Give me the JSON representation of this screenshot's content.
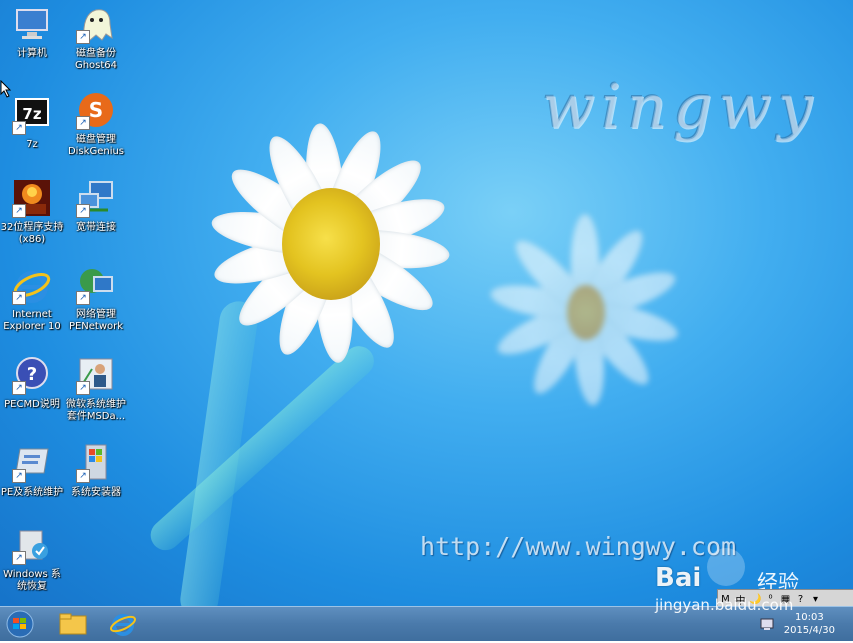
{
  "desktop": {
    "icons": [
      {
        "label": "计算机",
        "icon": "computer-icon"
      },
      {
        "label": "磁盘备份\nGhost64",
        "icon": "ghost-icon"
      },
      {
        "label": "7z",
        "icon": "7zip-icon"
      },
      {
        "label": "磁盘管理\nDiskGenius",
        "icon": "diskgenius-icon"
      },
      {
        "label": "32位程序支持\n(x86)",
        "icon": "x86-support-icon"
      },
      {
        "label": "宽带连接",
        "icon": "broadband-icon"
      },
      {
        "label": "Internet\nExplorer 10",
        "icon": "ie-icon"
      },
      {
        "label": "网络管理\nPENetwork",
        "icon": "network-icon"
      },
      {
        "label": "PECMD说明",
        "icon": "help-icon"
      },
      {
        "label": "微软系统维护\n套件MSDa...",
        "icon": "msdart-icon"
      },
      {
        "label": "PE及系统维护",
        "icon": "pe-maintenance-icon"
      },
      {
        "label": "系统安装器",
        "icon": "installer-icon"
      },
      {
        "label": "Windows 系\n统恢复",
        "icon": "recovery-icon"
      }
    ],
    "watermark_logo": "wingwy",
    "watermark_url": "http://www.wingwy.com",
    "baidu_brand": "Bai",
    "baidu_brand_cn": "经验",
    "baidu_site": "jingyan.baidu.com"
  },
  "taskbar": {
    "buttons": [
      {
        "name": "start-button",
        "icon": "windows-logo-icon"
      },
      {
        "name": "file-explorer-button",
        "icon": "folder-icon"
      },
      {
        "name": "internet-explorer-button",
        "icon": "ie-icon"
      }
    ],
    "time": "10:03",
    "date": "2015/4/30",
    "ime_items": [
      "M",
      "中",
      "🌙",
      "⁰",
      "▦",
      "?",
      "▾"
    ]
  },
  "colors": {
    "taskbar": "#4a7aab",
    "sky": "#42aef0"
  }
}
